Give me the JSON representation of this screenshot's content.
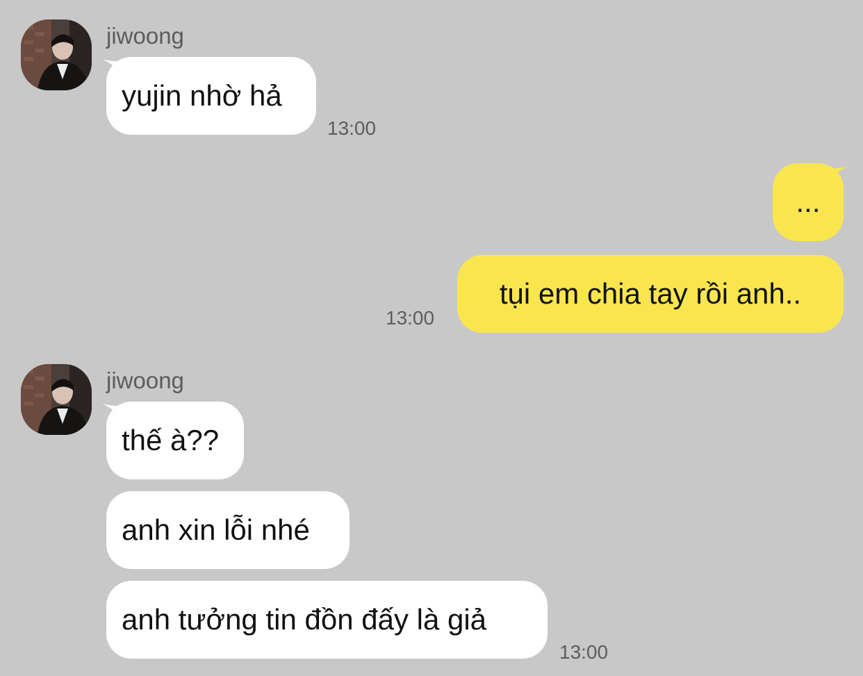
{
  "colors": {
    "background": "#c8c8c8",
    "incoming_bubble": "#ffffff",
    "outgoing_bubble": "#f9e64f",
    "meta_text": "#5c5c5c",
    "message_text": "#111111"
  },
  "messages": [
    {
      "sender": "jiwoong",
      "avatar_icon": "profile-photo",
      "lines": [
        "yujin nhờ hả"
      ],
      "time": "13:00"
    },
    {
      "sender": "me",
      "lines": [
        "...",
        "tụi em chia tay rồi anh.."
      ],
      "time": "13:00"
    },
    {
      "sender": "jiwoong",
      "avatar_icon": "profile-photo",
      "lines": [
        "thế à??",
        "anh xin lỗi nhé",
        "anh tưởng tin đồn đấy là giả"
      ],
      "time": "13:00"
    }
  ]
}
